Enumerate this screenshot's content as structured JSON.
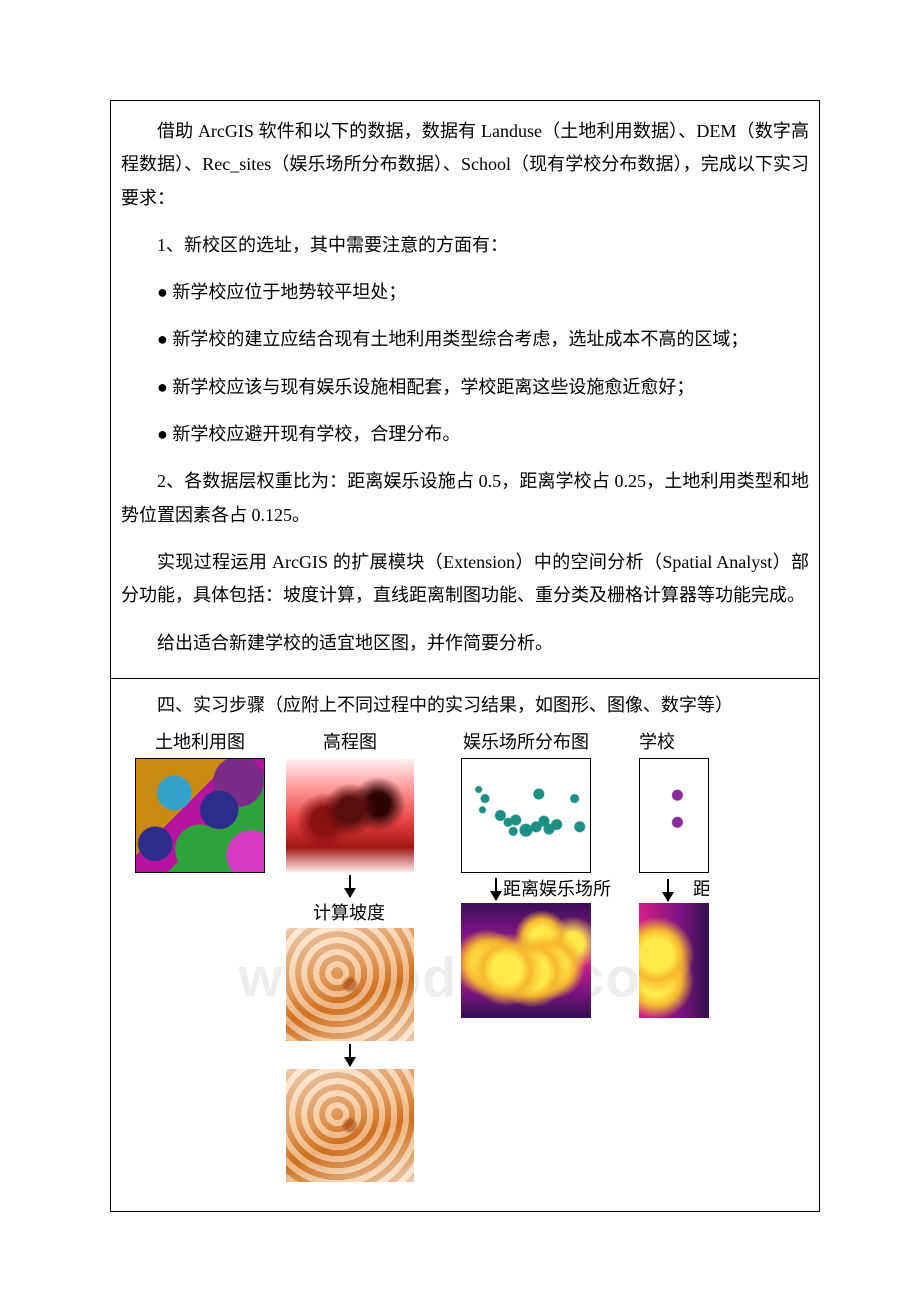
{
  "top": {
    "p1": "借助 ArcGIS 软件和以下的数据，数据有 Landuse（土地利用数据）、DEM（数字高程数据）、Rec_sites（娱乐场所分布数据）、School（现有学校分布数据），完成以下实习要求：",
    "p2": "1、新校区的选址，其中需要注意的方面有：",
    "b1": "● 新学校应位于地势较平坦处；",
    "b2": "● 新学校的建立应结合现有土地利用类型综合考虑，选址成本不高的区域；",
    "b3": "● 新学校应该与现有娱乐设施相配套，学校距离这些设施愈近愈好；",
    "b4": "● 新学校应避开现有学校，合理分布。",
    "p3": "2、各数据层权重比为：距离娱乐设施占 0.5，距离学校占 0.25，土地利用类型和地势位置因素各占 0.125。",
    "p4": "实现过程运用 ArcGIS 的扩展模块（Extension）中的空间分析（Spatial Analyst）部分功能，具体包括：坡度计算，直线距离制图功能、重分类及栅格计算器等功能完成。",
    "p5": "给出适合新建学校的适宜地区图，并作简要分析。"
  },
  "bottom": {
    "heading": "四、实习步骤（应附上不同过程中的实习结果，如图形、图像、数字等）"
  },
  "flow": {
    "col1_title": "土地利用图",
    "col2_title": "高程图",
    "col2_step1": "计算坡度",
    "col3_title": "娱乐场所分布图",
    "col3_step1": "距离娱乐场所",
    "col4_title": "学校",
    "col4_step1": "距"
  },
  "watermark": "www.bdocx.com"
}
